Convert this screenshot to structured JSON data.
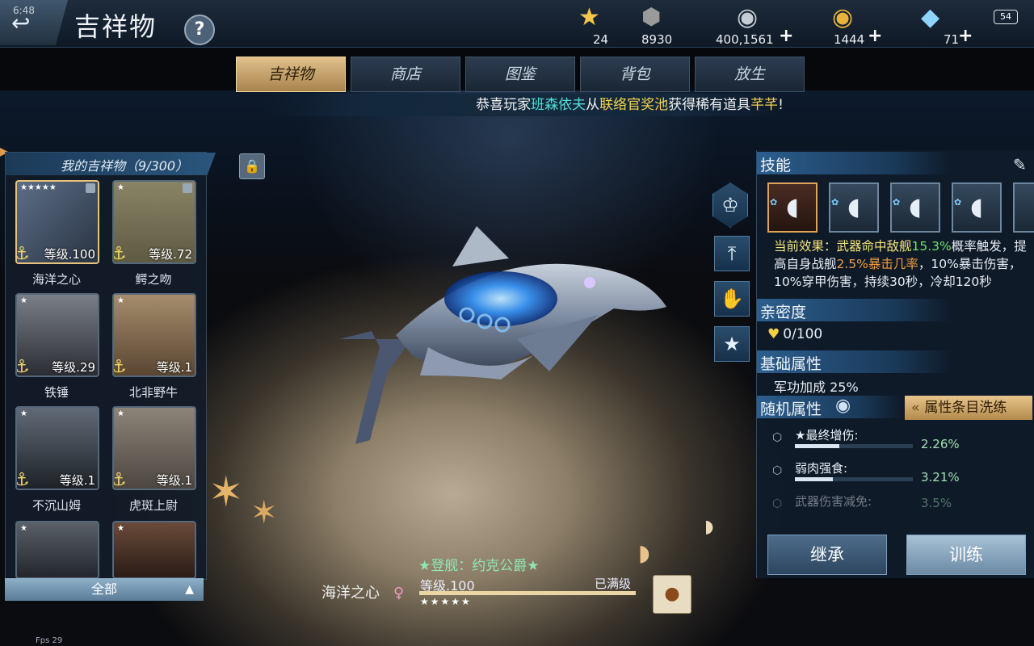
{
  "header": {
    "clock": "6:48",
    "title": "吉祥物",
    "help": "?",
    "battery": "54",
    "resources": [
      {
        "icon": "star-icon",
        "value": "24",
        "plus": ""
      },
      {
        "icon": "medal-icon",
        "value": "8930",
        "plus": ""
      },
      {
        "icon": "silver-coins-icon",
        "value": "400,1561",
        "plus": "+"
      },
      {
        "icon": "gold-coins-icon",
        "value": "1444",
        "plus": "+"
      },
      {
        "icon": "diamond-icon",
        "value": "71",
        "plus": "+"
      }
    ]
  },
  "tabs": [
    {
      "label": "吉祥物",
      "active": true
    },
    {
      "label": "商店",
      "active": false
    },
    {
      "label": "图鉴",
      "active": false
    },
    {
      "label": "背包",
      "active": false
    },
    {
      "label": "放生",
      "active": false
    }
  ],
  "announcement": {
    "p1": "恭喜玩家",
    "player": "班森依夫",
    "p2": "从",
    "pool": "联络官奖池",
    "p3": "获得稀有道具",
    "item": "芊芊",
    "p4": "!"
  },
  "my_pets": {
    "header": "我的吉祥物（9/300）",
    "filter": "全部",
    "items": [
      {
        "name": "海洋之心",
        "level": "等级.100",
        "stars": "★★★★★",
        "selected": true
      },
      {
        "name": "鳄之吻",
        "level": "等级.72",
        "stars": "★",
        "selected": false
      },
      {
        "name": "铁锤",
        "level": "等级.29",
        "stars": "★",
        "selected": false
      },
      {
        "name": "北非野牛",
        "level": "等级.1",
        "stars": "★",
        "selected": false
      },
      {
        "name": "不沉山姆",
        "level": "等级.1",
        "stars": "★",
        "selected": false
      },
      {
        "name": "虎斑上尉",
        "level": "等级.1",
        "stars": "★",
        "selected": false
      },
      {
        "name": "",
        "level": "",
        "stars": "★",
        "selected": false
      },
      {
        "name": "",
        "level": "",
        "stars": "★",
        "selected": false
      }
    ]
  },
  "pet_detail": {
    "docked": "★登舰：约克公爵★",
    "name": "海洋之心",
    "level": "等级.100",
    "maxed": "已满级",
    "stars": "★★★★★",
    "xp_fraction": 1.0
  },
  "skills": {
    "title": "技能",
    "desc_parts": {
      "a": "当前效果：武器命中敌舰",
      "b": "15.3%",
      "c": "概率触发，提高自身战舰",
      "d": "2.5%暴击几率",
      "e": "，10%暴击伤害，10%穿甲伤害，持续3",
      "f": "0秒，冷却120秒"
    }
  },
  "affinity": {
    "title": "亲密度",
    "value": "0/100"
  },
  "base_attr": {
    "title": "基础属性",
    "text": "军功加成 25%"
  },
  "random_attr": {
    "title": "随机属性",
    "reroll": "属性条目洗练",
    "items": [
      {
        "name": "★最终增伤:",
        "value": "2.26%",
        "fraction": 0.38
      },
      {
        "name": "弱肉强食:",
        "value": "3.21%",
        "fraction": 0.32
      },
      {
        "name": "武器伤害减免:",
        "value": "3.5%",
        "fraction": 0.5
      }
    ]
  },
  "buttons": {
    "inherit": "继承",
    "train": "训练"
  },
  "fps": "Fps 29"
}
